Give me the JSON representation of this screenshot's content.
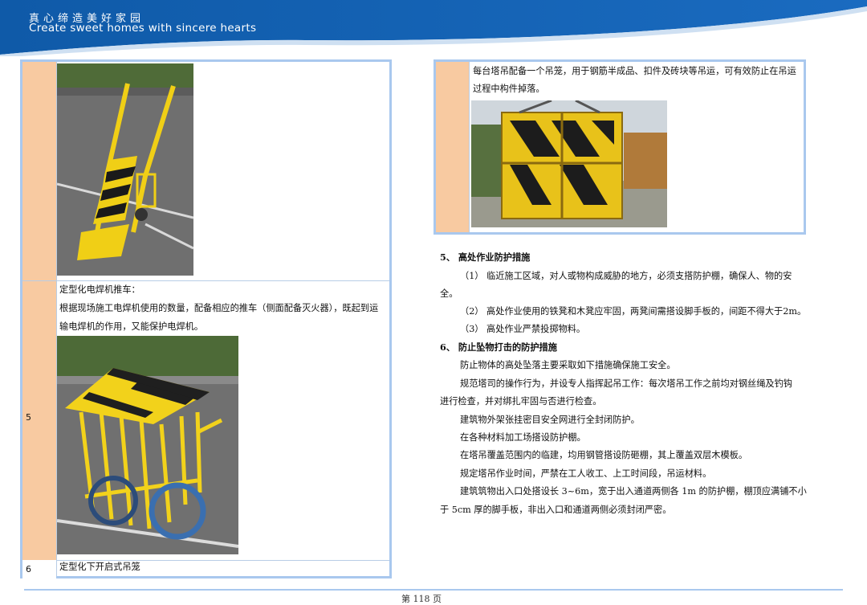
{
  "banner": {
    "title_cn": "真心缔造美好家园",
    "title_en": "Create sweet homes with sincere hearts"
  },
  "left_table": {
    "rows": [
      {
        "num": "5",
        "title": "定型化电焊机推车：",
        "desc_line1": "根据现场施工电焊机使用的数量，配备相应的推车（侧面配备灭火器），既起到运",
        "desc_line2": "输电焊机的作用，又能保护电焊机。"
      },
      {
        "num": "6",
        "title": "定型化下开启式吊笼"
      }
    ]
  },
  "right_box": {
    "line1": "每台塔吊配备一个吊笼，用于钢筋半成品、扣件及砖块等吊运，可有效防止在吊运",
    "line2": "过程中构件掉落。"
  },
  "sections": {
    "s5_heading": "5、 高处作业防护措施",
    "s5_p1a": "（1） 临近施工区域，对人或物构成威胁的地方，必须支搭防护棚，确保人、物的安",
    "s5_p1b": "全。",
    "s5_p2": "（2） 高处作业使用的铁凳和木凳应牢固，两凳间需搭设脚手板的，间距不得大于2m。",
    "s5_p3": "（3） 高处作业严禁投掷物料。",
    "s6_heading": "6、 防止坠物打击的防护措施",
    "s6_p1": "防止物体的高处坠落主要采取如下措施确保施工安全。",
    "s6_p2a": "规范塔司的操作行为，并设专人指挥起吊工作：每次塔吊工作之前均对钢丝绳及钓钩",
    "s6_p2b": "进行检查，并对绑扎牢固与否进行检查。",
    "s6_p3": "建筑物外架张挂密目安全网进行全封闭防护。",
    "s6_p4": "在各种材料加工场搭设防护棚。",
    "s6_p5": "在塔吊覆盖范围内的临建，均用钢管搭设防砸棚，其上覆盖双层木模板。",
    "s6_p6": "规定塔吊作业时间，严禁在工人收工、上工时间段，吊运材料。",
    "s6_p7a": "建筑筑物出入口处搭设长 3~6m，宽于出入通道两侧各 1m 的防护棚，棚顶应满铺不小",
    "s6_p7b": "于 5cm 厚的脚手板，非出入口和通道两侧必须封闭严密。"
  },
  "footer": {
    "page": "第 118 页"
  },
  "colors": {
    "banner_blue": "#1462b3",
    "border_blue": "#a9c8ee",
    "num_column": "#f8caa1"
  }
}
